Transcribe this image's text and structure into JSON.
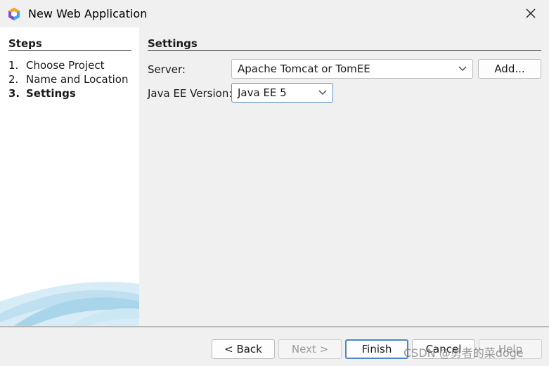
{
  "window": {
    "title": "New Web Application"
  },
  "steps": {
    "title": "Steps",
    "items": [
      {
        "num": "1.",
        "label": "Choose Project"
      },
      {
        "num": "2.",
        "label": "Name and Location"
      },
      {
        "num": "3.",
        "label": "Settings"
      }
    ]
  },
  "settings": {
    "title": "Settings",
    "server_label": "Server:",
    "server_value": "Apache Tomcat or TomEE",
    "add_button": "Add...",
    "javaee_label": "Java EE Version:",
    "javaee_value": "Java EE 5"
  },
  "footer": {
    "back": "< Back",
    "next": "Next >",
    "finish": "Finish",
    "cancel": "Cancel",
    "help": "Help"
  },
  "watermark": "CSDN @勇者的菜doge"
}
